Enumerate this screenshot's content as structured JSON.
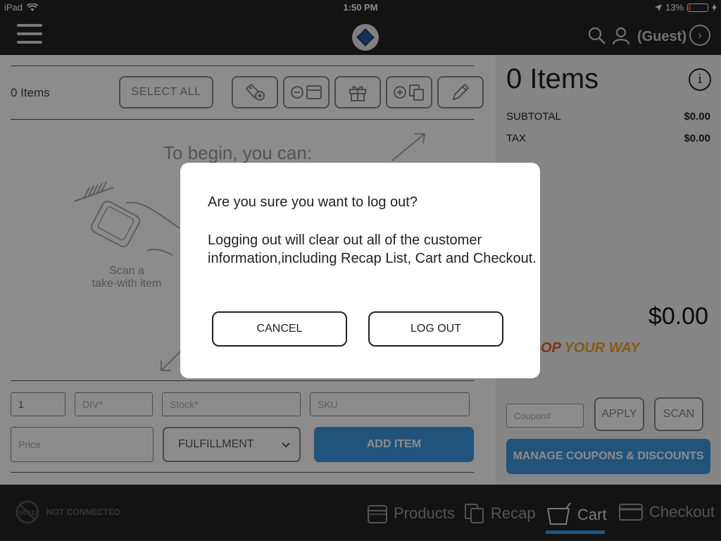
{
  "status_bar": {
    "device": "iPad",
    "time": "1:50 PM",
    "battery": "13%",
    "battery_level": 0.13
  },
  "header": {
    "user": "(Guest)"
  },
  "cart": {
    "items_count": "0 Items",
    "select_all": "SELECT ALL",
    "empty_title": "To begin, you can:",
    "scan_hint_line1": "Scan a",
    "scan_hint_line2": "take-with item",
    "form": {
      "qty_value": "1",
      "div_placeholder": "DIV*",
      "stock_placeholder": "Stock*",
      "sku_placeholder": "SKU",
      "price_placeholder": "Price",
      "fulfillment": "FULFILLMENT",
      "add_item": "ADD ITEM"
    }
  },
  "summary": {
    "title": "0 Items",
    "subtotal_label": "SUBTOTAL",
    "subtotal_value": "$0.00",
    "tax_label": "TAX",
    "tax_value": "$0.00",
    "total": "$0.00",
    "syw_part1": "OP ",
    "syw_part2": "YOUR WAY",
    "coupon_placeholder": "Coupon#",
    "apply": "APPLY",
    "scan": "SCAN",
    "manage": "MANAGE COUPONS & DISCOUNTS"
  },
  "bottom_bar": {
    "connection": "NOT CONNECTED",
    "nav": [
      "Products",
      "Recap",
      "Cart",
      "Checkout"
    ],
    "active": "Cart"
  },
  "modal": {
    "title": "Are you sure you want to log out?",
    "message": "Logging out will clear out all of the customer information,including Recap List, Cart and Checkout.",
    "cancel": "CANCEL",
    "logout": "LOG OUT"
  },
  "colors": {
    "accent": "#3f97e0",
    "bar": "#232323",
    "syw_orange": "#f05a23",
    "syw_yellow": "#f5a623"
  }
}
